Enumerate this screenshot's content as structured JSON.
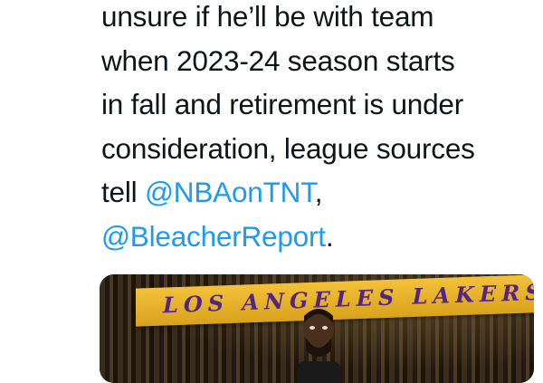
{
  "tweet": {
    "lines": [
      {
        "text": "unsure if he’ll be with team"
      },
      {
        "text": "when 2023-24 season starts"
      },
      {
        "text": "in fall and retirement is under"
      },
      {
        "text": "consideration, league sources"
      },
      {
        "prefix": "tell ",
        "mention": "@NBAonTNT",
        "suffix": ","
      },
      {
        "mention": "@BleacherReport",
        "suffix": "."
      }
    ]
  },
  "media": {
    "banner_text": "LOS ANGELES LAKERS",
    "colors": {
      "banner": "#f3c23a",
      "banner_text": "#552583",
      "mention": "#1d9bf0"
    }
  }
}
